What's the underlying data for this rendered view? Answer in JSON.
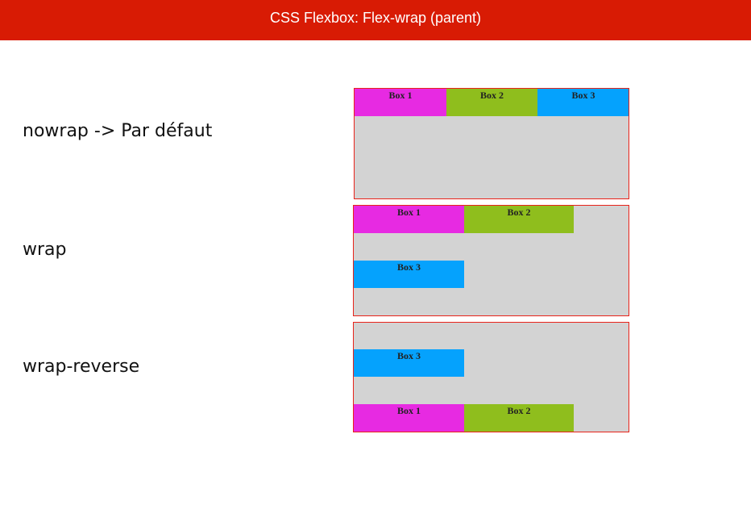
{
  "header": {
    "title": "CSS Flexbox: Flex-wrap (parent)"
  },
  "colors": {
    "header_bg": "#d81b04",
    "container_bg": "#d3d3d3",
    "container_border": "#e8231a",
    "box1": "#e72ae2",
    "box2": "#8fbe1d",
    "box3": "#05a2fd"
  },
  "rows": [
    {
      "label": "nowrap -> Par défaut",
      "boxes": [
        "Box 1",
        "Box 2",
        "Box 3"
      ]
    },
    {
      "label": "wrap",
      "boxes": [
        "Box 1",
        "Box 2",
        "Box 3"
      ]
    },
    {
      "label": "wrap-reverse",
      "boxes": [
        "Box 3",
        "Box 1",
        "Box 2"
      ]
    }
  ]
}
